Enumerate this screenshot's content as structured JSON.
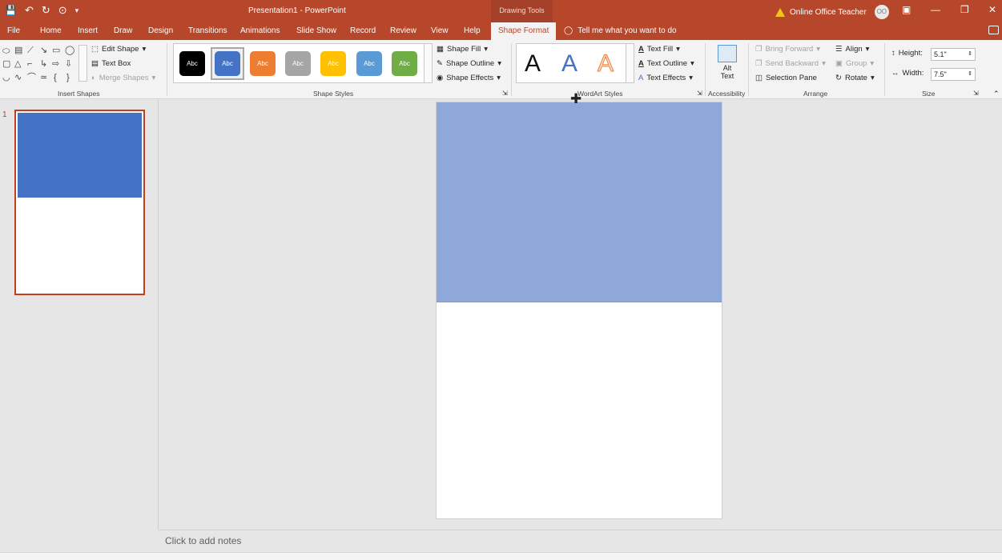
{
  "window": {
    "title": "Presentation1  -  PowerPoint",
    "contextual_group": "Drawing Tools",
    "user_name": "Online Office Teacher",
    "user_initials": "OO"
  },
  "quick_access": {
    "save_icon": "💾",
    "undo_icon": "↶",
    "redo_icon": "↻",
    "touch_icon": "⊙",
    "customize_icon": "▾"
  },
  "window_controls": {
    "ribbon_display": "▣",
    "minimize": "—",
    "restore": "❐",
    "close": "✕"
  },
  "tabs": [
    "File",
    "Home",
    "Insert",
    "Draw",
    "Design",
    "Transitions",
    "Animations",
    "Slide Show",
    "Record",
    "Review",
    "View",
    "Help",
    "Shape Format"
  ],
  "tell_me": "Tell me what you want to do",
  "ribbon": {
    "insert_shapes": {
      "label": "Insert Shapes",
      "edit_shape": "Edit Shape",
      "text_box": "Text Box",
      "merge_shapes": "Merge Shapes"
    },
    "shape_styles": {
      "label": "Shape Styles",
      "thumb_text": "Abc",
      "shape_fill": "Shape Fill",
      "shape_outline": "Shape Outline",
      "shape_effects": "Shape Effects",
      "colors": [
        "#000000",
        "#4472c4",
        "#ed7d31",
        "#a5a5a5",
        "#ffc000",
        "#5b9bd5",
        "#70ad47"
      ]
    },
    "wordart": {
      "label": "WordArt Styles",
      "letter": "A",
      "text_fill": "Text Fill",
      "text_outline": "Text Outline",
      "text_effects": "Text Effects"
    },
    "accessibility": {
      "label": "Accessibility",
      "alt_text_line1": "Alt",
      "alt_text_line2": "Text"
    },
    "arrange": {
      "label": "Arrange",
      "bring_forward": "Bring Forward",
      "send_backward": "Send Backward",
      "selection_pane": "Selection Pane",
      "align": "Align",
      "group": "Group",
      "rotate": "Rotate"
    },
    "size": {
      "label": "Size",
      "height_label": "Height:",
      "height_value": "5.1\"",
      "width_label": "Width:",
      "width_value": "7.5\""
    }
  },
  "thumbnails": {
    "slide_number": "1"
  },
  "slide": {
    "shape_color": "#8fa8da",
    "thumb_shape_color": "#4472c4"
  },
  "notes": {
    "placeholder": "Click to add notes"
  }
}
